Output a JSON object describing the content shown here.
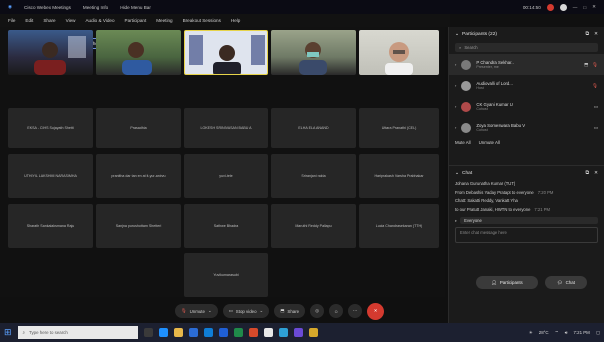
{
  "window": {
    "title": "Cisco Webex Meetings",
    "meeting_info": "Meeting Info",
    "hide_menu": "Hide Menu Bar",
    "time": "00:14:50"
  },
  "menu": [
    "File",
    "Edit",
    "Share",
    "View",
    "Audio & Video",
    "Participant",
    "Meeting",
    "Breakout Sessions",
    "Help"
  ],
  "speaking": "Speaking: Zoya Someswara Babu V (Cohost)",
  "tiles": [
    "EKSA - CIHS Sujayath Shetti",
    "Prasadhia",
    "LOKESH SRINIVASAN BABU A",
    "ELHA ELA ANAND",
    "Uttara Pranathi (CEL)",
    "UTHIYIL LAKSHMI NARASIMHA",
    "pranitha dar tan en at it-yur-anirvu",
    "yuvi-tele",
    "Sriranjani rakta",
    "Hariprakash Varsha Prabhakar",
    "Sharath Sankalaksmana Raju",
    "Sanjna purushottam Shetteri",
    "Sathwe Bhadra",
    "Maruthi Reddy Pallapu",
    "Lucia Chandrasekaran (TTH)",
    "Yuvikumarasubi"
  ],
  "toolbar": {
    "unmute": "Unmute",
    "start_video": "Stop video",
    "share": "Share"
  },
  "participants": {
    "header": "Participants (22)",
    "search_placeholder": "Search",
    "list": [
      {
        "name": "P Chandra Sekhar..",
        "role": "Presenter, me"
      },
      {
        "name": "Audiovalli of Lord...",
        "role": "Host"
      },
      {
        "name": "CK Gyani Kumar U",
        "role": "Cohost"
      },
      {
        "name": "Zoya Someswara Babu V",
        "role": "Cohost"
      }
    ],
    "mute_all": "Mute All",
    "unmute_all": "Unmute All"
  },
  "chat": {
    "header": "Chat",
    "messages": [
      {
        "text": "Johana Gurunatha Kumar (TUT)",
        "time": ""
      },
      {
        "text": "From Debashis Yaday Pratapt to everyone",
        "time": "7:20 PM"
      },
      {
        "text": "Chatt: Sakatti Reddy, Vankatt Yha",
        "time": ""
      },
      {
        "text": "to our Pratutt Janaki, HWTN to everyone",
        "time": "7:21 PM"
      }
    ],
    "to_label": "Everyone",
    "input_placeholder": "Enter chat message here"
  },
  "panel_buttons": {
    "participants": "Participants",
    "chat": "Chat"
  },
  "taskbar": {
    "search_placeholder": "Type here to search",
    "temp": "28°C",
    "clock": "7:21 PM"
  },
  "colors": {
    "accent": "#6a8bd6",
    "leave": "#d43a2f"
  }
}
